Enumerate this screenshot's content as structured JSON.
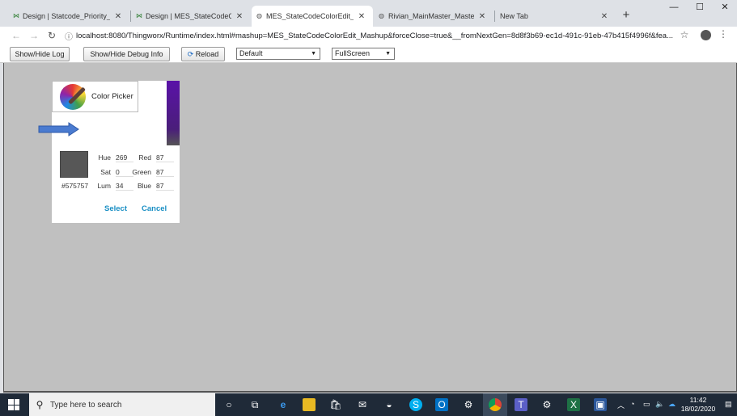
{
  "browser": {
    "tabs": [
      {
        "title": "Design | Statcode_Priority_Ne",
        "favicon": "thingworx-icon"
      },
      {
        "title": "Design | MES_StateCodeColor",
        "favicon": "thingworx-icon"
      },
      {
        "title": "MES_StateCodeColorEdit_Ma",
        "favicon": "globe-icon"
      },
      {
        "title": "Rivian_MainMaster_Master_S",
        "favicon": "globe-icon"
      },
      {
        "title": "New Tab",
        "favicon": ""
      }
    ],
    "url": "localhost:8080/Thingworx/Runtime/index.html#mashup=MES_StateCodeColorEdit_Mashup&forceClose=true&__fromNextGen=8d8f3b69-ec1d-491c-91eb-47b415f4996f&fea..."
  },
  "appbar": {
    "show_hide_log": "Show/Hide Log",
    "show_hide_debug": "Show/Hide Debug Info",
    "reload": "Reload",
    "select_default": "Default",
    "select_fullscreen": "FullScreen"
  },
  "color_picker": {
    "label": "Color Picker",
    "hex": "#575757",
    "swatch_color": "#575757",
    "accent_color": "#5a12a8",
    "fields": {
      "hue_label": "Hue",
      "hue": "269",
      "sat_label": "Sat",
      "sat": "0",
      "lum_label": "Lum",
      "lum": "34",
      "red_label": "Red",
      "red": "87",
      "green_label": "Green",
      "green": "87",
      "blue_label": "Blue",
      "blue": "87"
    },
    "select_label": "Select",
    "cancel_label": "Cancel"
  },
  "taskbar": {
    "search_placeholder": "Type here to search",
    "time": "11:42",
    "date": "18/02/2020"
  }
}
